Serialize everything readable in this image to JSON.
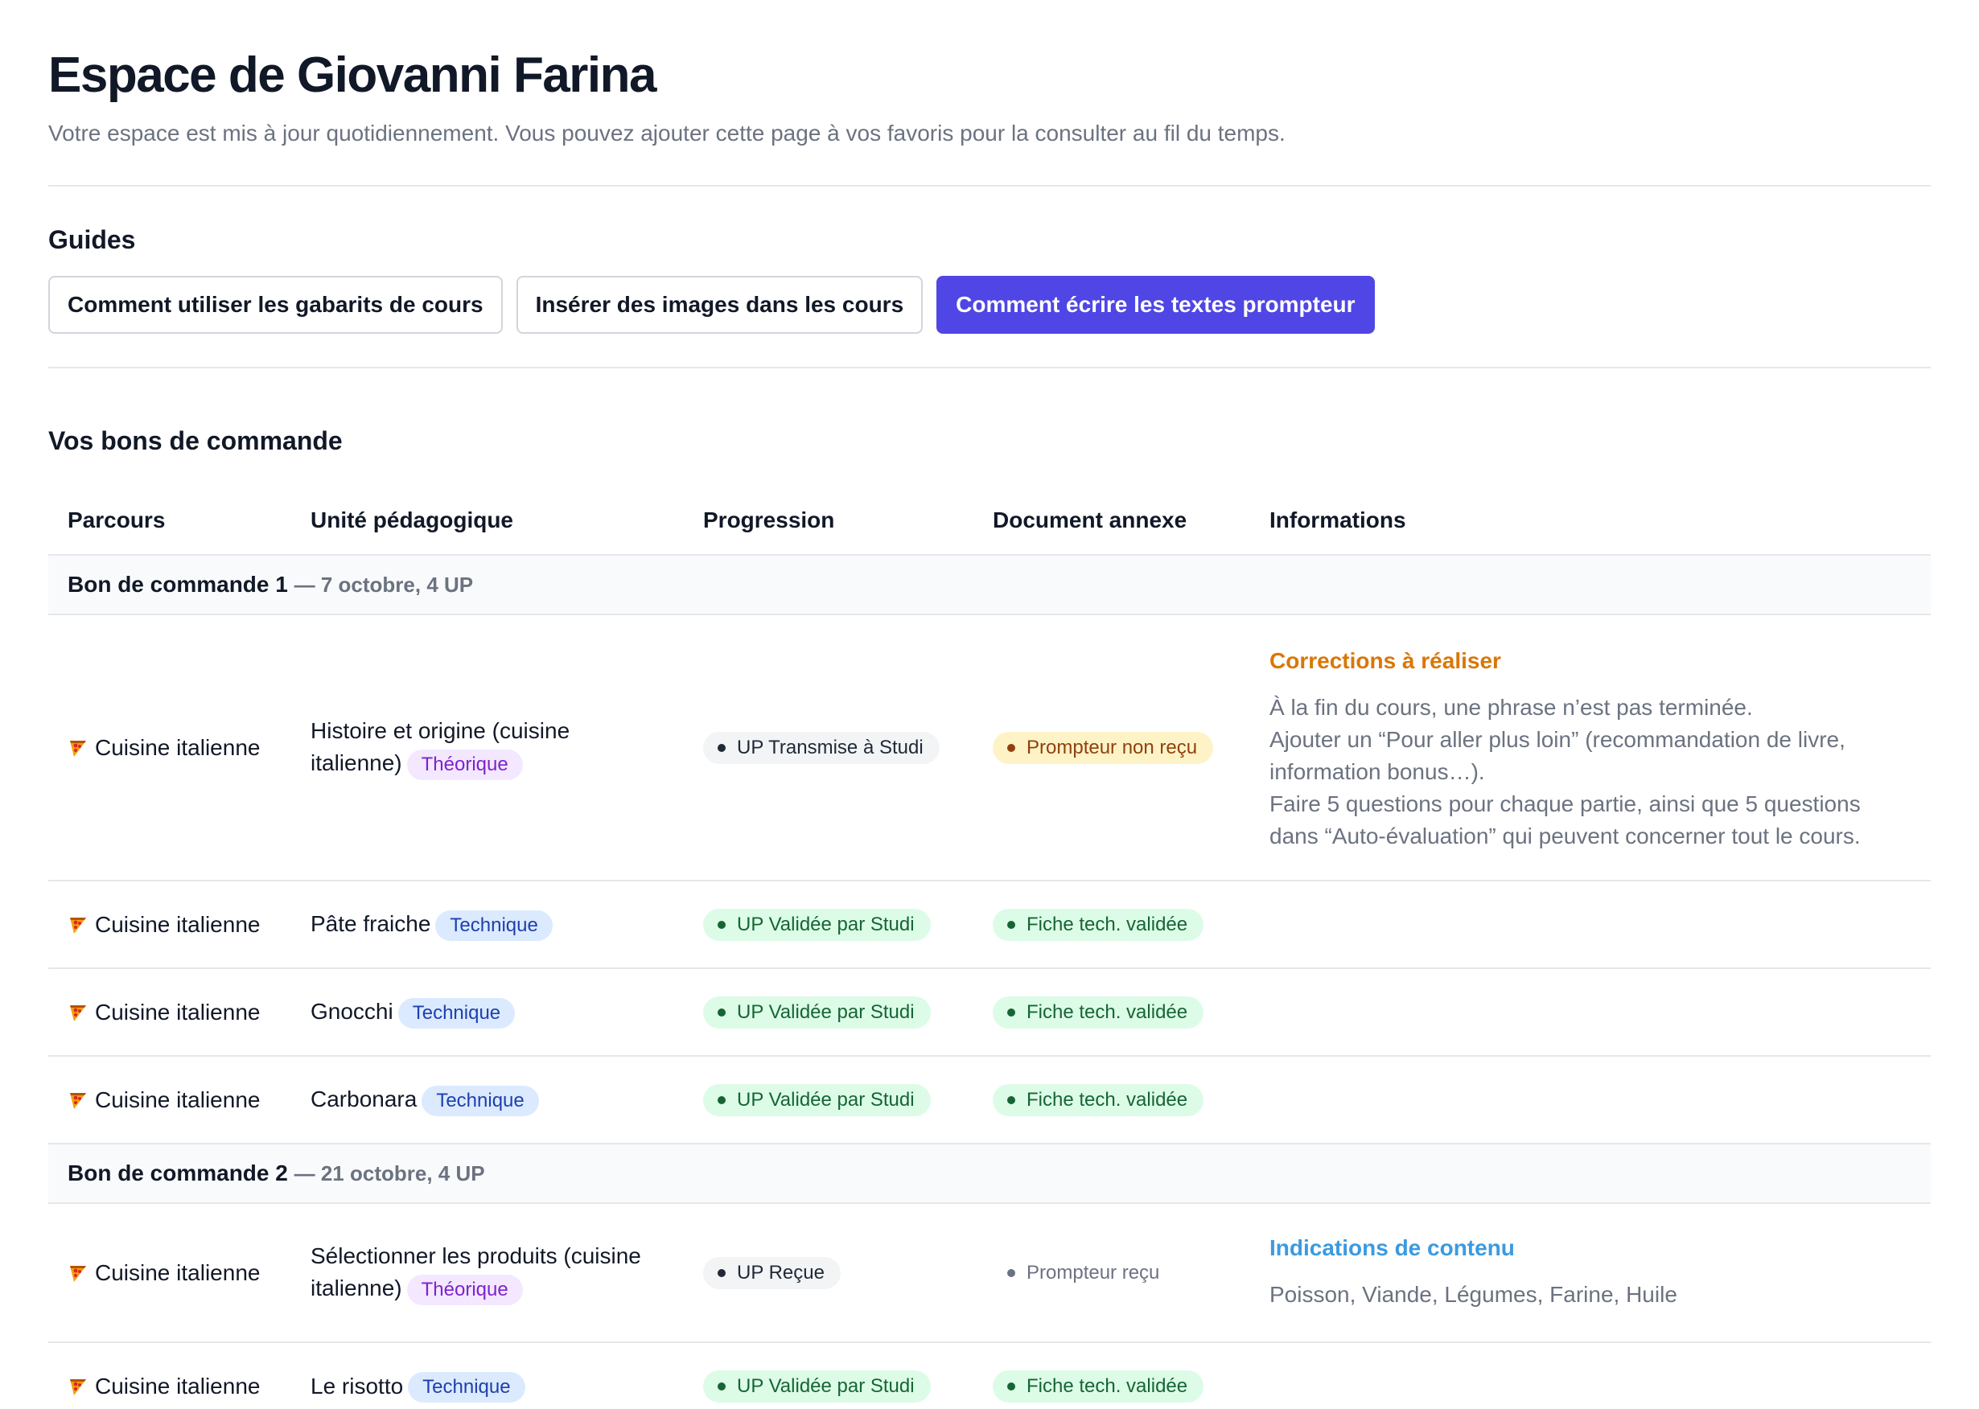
{
  "header": {
    "title": "Espace de Giovanni Farina",
    "subtitle": "Votre espace est mis à jour quotidiennement. Vous pouvez ajouter cette page à vos favoris pour la consulter au fil du temps."
  },
  "guides": {
    "title": "Guides",
    "buttons": [
      "Comment utiliser les gabarits de cours",
      "Insérer des images dans les cours",
      "Comment écrire les textes prompteur"
    ]
  },
  "orders": {
    "title": "Vos bons de commande",
    "columns": [
      "Parcours",
      "Unité pédagogique",
      "Progression",
      "Document annexe",
      "Informations"
    ],
    "groups": [
      {
        "name": "Bon de commande 1",
        "meta": "— 7 octobre, 4 UP",
        "rows": [
          {
            "parcours": "Cuisine italienne",
            "unit": "Histoire et origine (cuisine italienne)",
            "tag": "Théorique",
            "progression": "UP Transmise à Studi",
            "document": "Prompteur non reçu",
            "info_title": "Corrections à réaliser",
            "info_lines": [
              "À la fin du cours, une phrase n’est pas terminée.",
              "Ajouter un “Pour aller plus loin” (recommandation de livre, information bonus…).",
              "Faire 5 questions pour chaque partie, ainsi que 5 questions dans “Auto-évaluation” qui peuvent concerner tout le cours."
            ]
          },
          {
            "parcours": "Cuisine italienne",
            "unit": "Pâte fraiche",
            "tag": "Technique",
            "progression": "UP Validée par Studi",
            "document": "Fiche tech. validée"
          },
          {
            "parcours": "Cuisine italienne",
            "unit": "Gnocchi",
            "tag": "Technique",
            "progression": "UP Validée par Studi",
            "document": "Fiche tech. validée"
          },
          {
            "parcours": "Cuisine italienne",
            "unit": "Carbonara",
            "tag": "Technique",
            "progression": "UP Validée par Studi",
            "document": "Fiche tech. validée"
          }
        ]
      },
      {
        "name": "Bon de commande 2",
        "meta": "— 21 octobre, 4 UP",
        "rows": [
          {
            "parcours": "Cuisine italienne",
            "unit": "Sélectionner les produits (cuisine italienne)",
            "tag": "Théorique",
            "progression": "UP Reçue",
            "document": "Prompteur reçu",
            "info_title": "Indications de contenu",
            "info_text": "Poisson, Viande, Légumes, Farine, Huile"
          },
          {
            "parcours": "Cuisine italienne",
            "unit": "Le risotto",
            "tag": "Technique",
            "progression": "UP Validée par Studi",
            "document": "Fiche tech. validée"
          }
        ]
      }
    ]
  },
  "colors": {
    "accent": "#4f46e5",
    "corrections_title": "#d97706",
    "indications_title": "#3b9ae1",
    "validated_bg": "#dcfce7",
    "pending_bg": "#fef3c7"
  },
  "icons": {
    "parcours": "pizza-icon"
  }
}
